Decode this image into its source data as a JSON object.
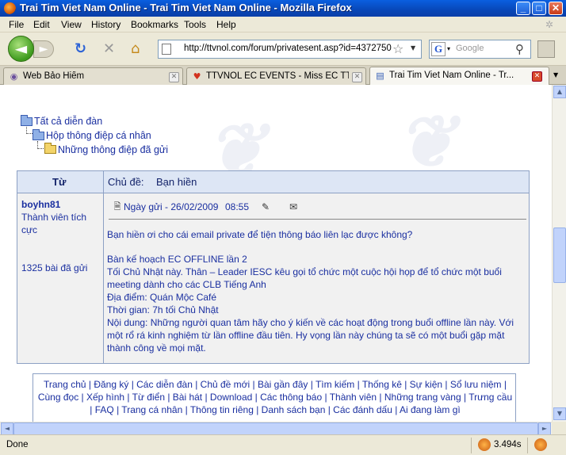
{
  "window": {
    "title": "Trai Tim Viet Nam Online - Trai Tim Viet Nam Online - Mozilla Firefox",
    "minimize": "_",
    "maximize": "□",
    "close": "✕"
  },
  "menu": [
    "File",
    "Edit",
    "View",
    "History",
    "Bookmarks",
    "Tools",
    "Help"
  ],
  "nav": {
    "url": "http://ttvnol.com/forum/privatesent.asp?id=4372750",
    "search_placeholder": "Google"
  },
  "tabs": [
    {
      "label": "Web Bảo Hiểm",
      "active": false
    },
    {
      "label": "TTVNOL EC EVENTS - Miss EC TTV...",
      "active": false
    },
    {
      "label": "Trai Tim Viet Nam Online - Tr...",
      "active": true
    }
  ],
  "breadcrumb": {
    "root": "Tất cả diễn đàn",
    "level1": "Hộp thông điệp cá nhân",
    "level2": "Những thông điệp đã gửi"
  },
  "message": {
    "from_header": "Từ",
    "subject_label": "Chủ đề:",
    "subject": "Bạn hiền",
    "sender": "boyhn81",
    "rank": "Thành viên tích cực",
    "posts": "1325 bài đã gửi",
    "sent_label": "Ngày gửi - 26/02/2009",
    "sent_time": "08:55",
    "body": [
      "Bạn hiền ơi cho cái email private để tiện thông báo liên lạc được không?",
      "",
      "Bàn kế hoạch EC OFFLINE lần 2",
      "Tối Chủ Nhật này. Thân – Leader IESC kêu gọi tổ chức một cuộc hội họp để tổ chức một buổi meeting dành cho các CLB Tiếng Anh",
      "Địa điểm: Quán Mộc Café",
      "Thời gian: 7h tối Chủ Nhật",
      "Nội dung: Những người quan tâm hãy cho ý kiến về các hoạt động trong buổi offline lần này. Với một rổ rá kinh nghiệm từ lần offline đầu tiên. Hy vọng lần này chúng ta sẽ có một buổi gặp mặt thành công về mọi mặt."
    ]
  },
  "footer_links": "Trang chủ | Đăng ký | Các diễn đàn | Chủ đề mới | Bài gần đây | Tìm kiếm | Thống kê | Sự kiện | Sổ lưu niệm | Cùng đọc | Xếp hình | Từ điển | Bài hát | Download | Các thông báo | Thành viên | Những trang vàng | Trưng cầu | FAQ | Trang cá nhân | Thông tin riêng | Danh sách bạn | Các đánh dấu | Ai đang làm gì",
  "status": {
    "text": "Done",
    "timing": "3.494s"
  }
}
